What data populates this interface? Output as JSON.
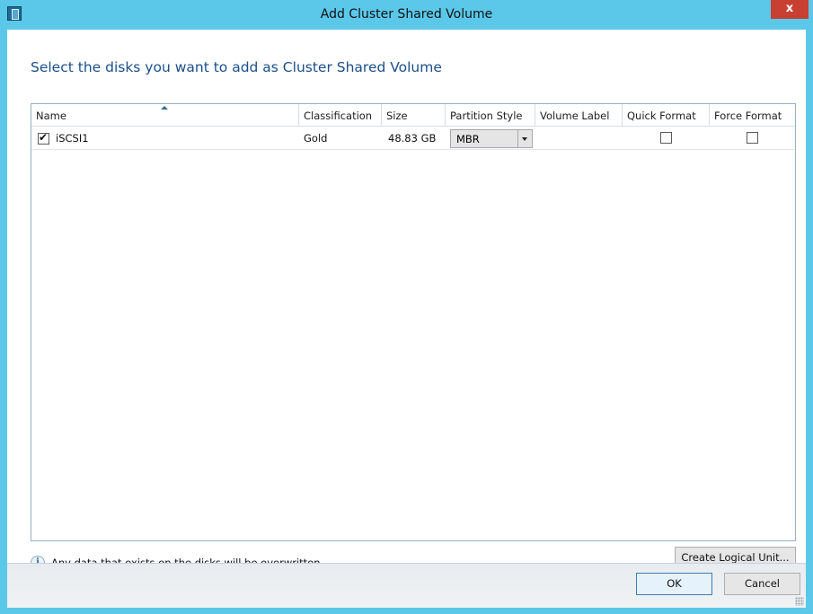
{
  "window": {
    "title": "Add Cluster Shared Volume",
    "close_label": "x"
  },
  "instruction": "Select the disks you want to add as Cluster Shared Volume",
  "table": {
    "columns": [
      "Name",
      "Classification",
      "Size",
      "Partition Style",
      "Volume Label",
      "Quick Format",
      "Force Format"
    ],
    "sorted_column": "Name",
    "rows": [
      {
        "selected": true,
        "name": "iSCSI1",
        "classification": "Gold",
        "size": "48.83 GB",
        "partition_style": "MBR",
        "volume_label": "",
        "quick_format": false,
        "force_format": false
      }
    ]
  },
  "info": {
    "icon": "info-icon",
    "text": "Any data that exists on the disks will be overwritten."
  },
  "buttons": {
    "create_logical_unit": "Create Logical Unit...",
    "ok": "OK",
    "cancel": "Cancel"
  },
  "colors": {
    "titlebar": "#5bc8ea",
    "close": "#c84031",
    "instruction": "#1b4f8a"
  }
}
